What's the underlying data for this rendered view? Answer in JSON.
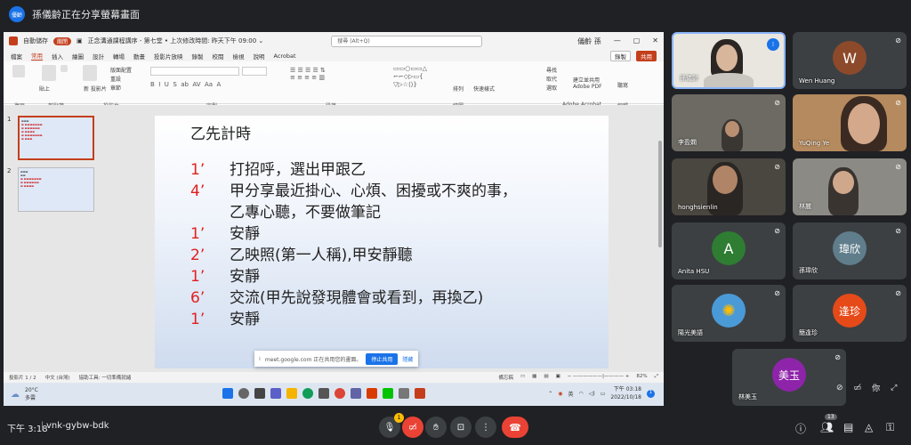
{
  "topbar": {
    "badge": "優齡",
    "presenting_text": "孫儀齡正在分享螢幕畫面"
  },
  "ppt": {
    "titlebar": {
      "autosave_label": "自動儲存",
      "autosave_state": "關閉",
      "doc_title": "正念溝通課程講序 - 第七堂 • 上次修改時間: 昨天下午 09:00 ⌄",
      "search_placeholder": "搜尋 (Alt+Q)",
      "user": "儀齡 孫"
    },
    "menu": [
      "檔案",
      "常用",
      "插入",
      "繪圖",
      "設計",
      "轉場",
      "動畫",
      "投影片放映",
      "錄製",
      "校閱",
      "檢視",
      "說明",
      "Acrobat"
    ],
    "menu_active": "常用",
    "record_button": "錄製",
    "share_button": "共用",
    "ribbon_groups": [
      "復原",
      "剪貼簿",
      "投影片",
      "字型",
      "段落",
      "繪圖",
      "Adobe Acrobat",
      "編輯"
    ],
    "ribbon_items": {
      "paste": "貼上",
      "new_slide": "新\n投影片",
      "layout": "版面配置",
      "reset": "重設",
      "section": "章節",
      "find": "尋找",
      "replace": "取代",
      "select": "選取",
      "adobe_pdf": "建立並共用\nAdobe PDF",
      "dictate": "聽寫",
      "arrange": "排列",
      "quick_styles": "快速樣式"
    },
    "thumbnails": [
      "1",
      "2"
    ],
    "slide": {
      "title": "乙先計時",
      "rows": [
        {
          "num": "1’",
          "text": "打招呼，選出甲跟乙"
        },
        {
          "num": "4’",
          "text": "甲分享最近掛心、心煩、困擾或不爽的事，"
        },
        {
          "num": "",
          "text": "乙專心聽，不要做筆記"
        },
        {
          "num": "1’",
          "text": "安靜"
        },
        {
          "num": "2’",
          "text": "乙映照(第一人稱),甲安靜聽"
        },
        {
          "num": "1’",
          "text": "安靜"
        },
        {
          "num": "6’",
          "text": "交流(甲先說發現體會或看到，再換乙)"
        },
        {
          "num": "1’",
          "text": "安靜"
        }
      ]
    },
    "share_notice": {
      "text": "meet.google.com 正在共用您的畫面。",
      "stop": "停止共用",
      "hide": "隱藏"
    },
    "statusbar": {
      "slide_count": "投影片 1 / 2",
      "language": "中文 (台灣)",
      "accessibility": "協助工具: 一切準備就緒",
      "notes": "備忘稿",
      "zoom": "82%"
    },
    "taskbar": {
      "temp": "20°C",
      "weather": "多雲",
      "ime": "英",
      "time": "下午 03:18",
      "date": "2022/10/18"
    }
  },
  "participants": [
    {
      "name": "孫儀齡",
      "type": "video",
      "speaking": true
    },
    {
      "name": "Wen Huang",
      "type": "avatar",
      "initial": "W",
      "color": "#8d4a2b"
    },
    {
      "name": "李盈嫻",
      "type": "video"
    },
    {
      "name": "YuQing Ye",
      "type": "video"
    },
    {
      "name": "honghsienlin",
      "type": "video"
    },
    {
      "name": "林麗",
      "type": "video"
    },
    {
      "name": "Anita HSU",
      "type": "avatar",
      "initial": "A",
      "color": "#2e7d32"
    },
    {
      "name": "孫瑋欣",
      "type": "avatar",
      "initial": "瑋欣",
      "color": "#607d8b"
    },
    {
      "name": "陽光美語",
      "type": "avatar",
      "initial": "",
      "color": "#4a9ad8"
    },
    {
      "name": "簡逢珍",
      "type": "avatar",
      "initial": "逢珍",
      "color": "#e64a19"
    },
    {
      "name": "林美玉",
      "type": "avatar",
      "initial": "美玉",
      "color": "#8e24aa"
    }
  ],
  "self_tile": {
    "label": "你"
  },
  "bottombar": {
    "time": "下午 3:18",
    "meeting_code": "vnk-gybw-bdk",
    "mic_badge": "1",
    "people_count": "13"
  }
}
